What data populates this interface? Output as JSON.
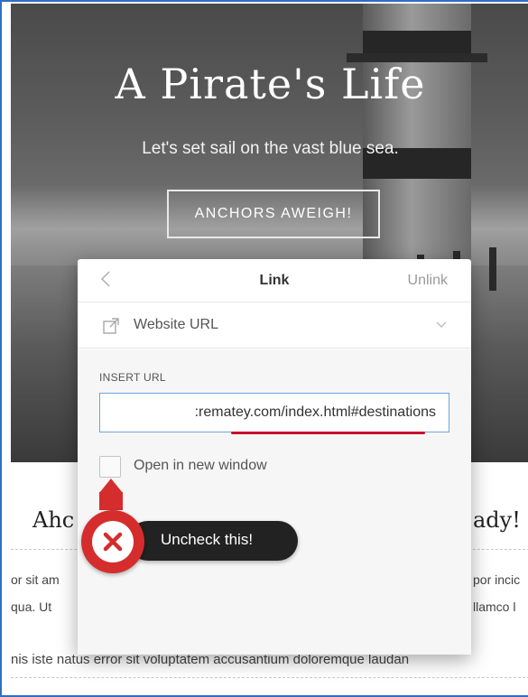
{
  "hero": {
    "title": "A Pirate's Life",
    "subtitle": "Let's set sail on the vast blue sea.",
    "button_label": "ANCHORS AWEIGH!"
  },
  "content": {
    "heading_left": "Ahc",
    "heading_right": "ady!",
    "para1_left": "or sit am",
    "para1_right": "por incic",
    "para2_left": "qua.  Ut",
    "para2_right": "llamco l",
    "para3": "nis iste natus error sit voluptatem accusantium doloremque laudan"
  },
  "link_popover": {
    "title": "Link",
    "unlink_label": "Unlink",
    "link_type": "Website URL",
    "url_label": "INSERT URL",
    "url_value": ":rematey.com/index.html#destinations",
    "open_new_window_label": "Open in new window",
    "open_new_window_checked": false
  },
  "annotation": {
    "text": "Uncheck this!",
    "accent_color": "#d52d2d"
  },
  "colors": {
    "accent_red": "#c8102e",
    "input_border": "#6aa7e0",
    "frame_border": "#2f6fc4"
  }
}
